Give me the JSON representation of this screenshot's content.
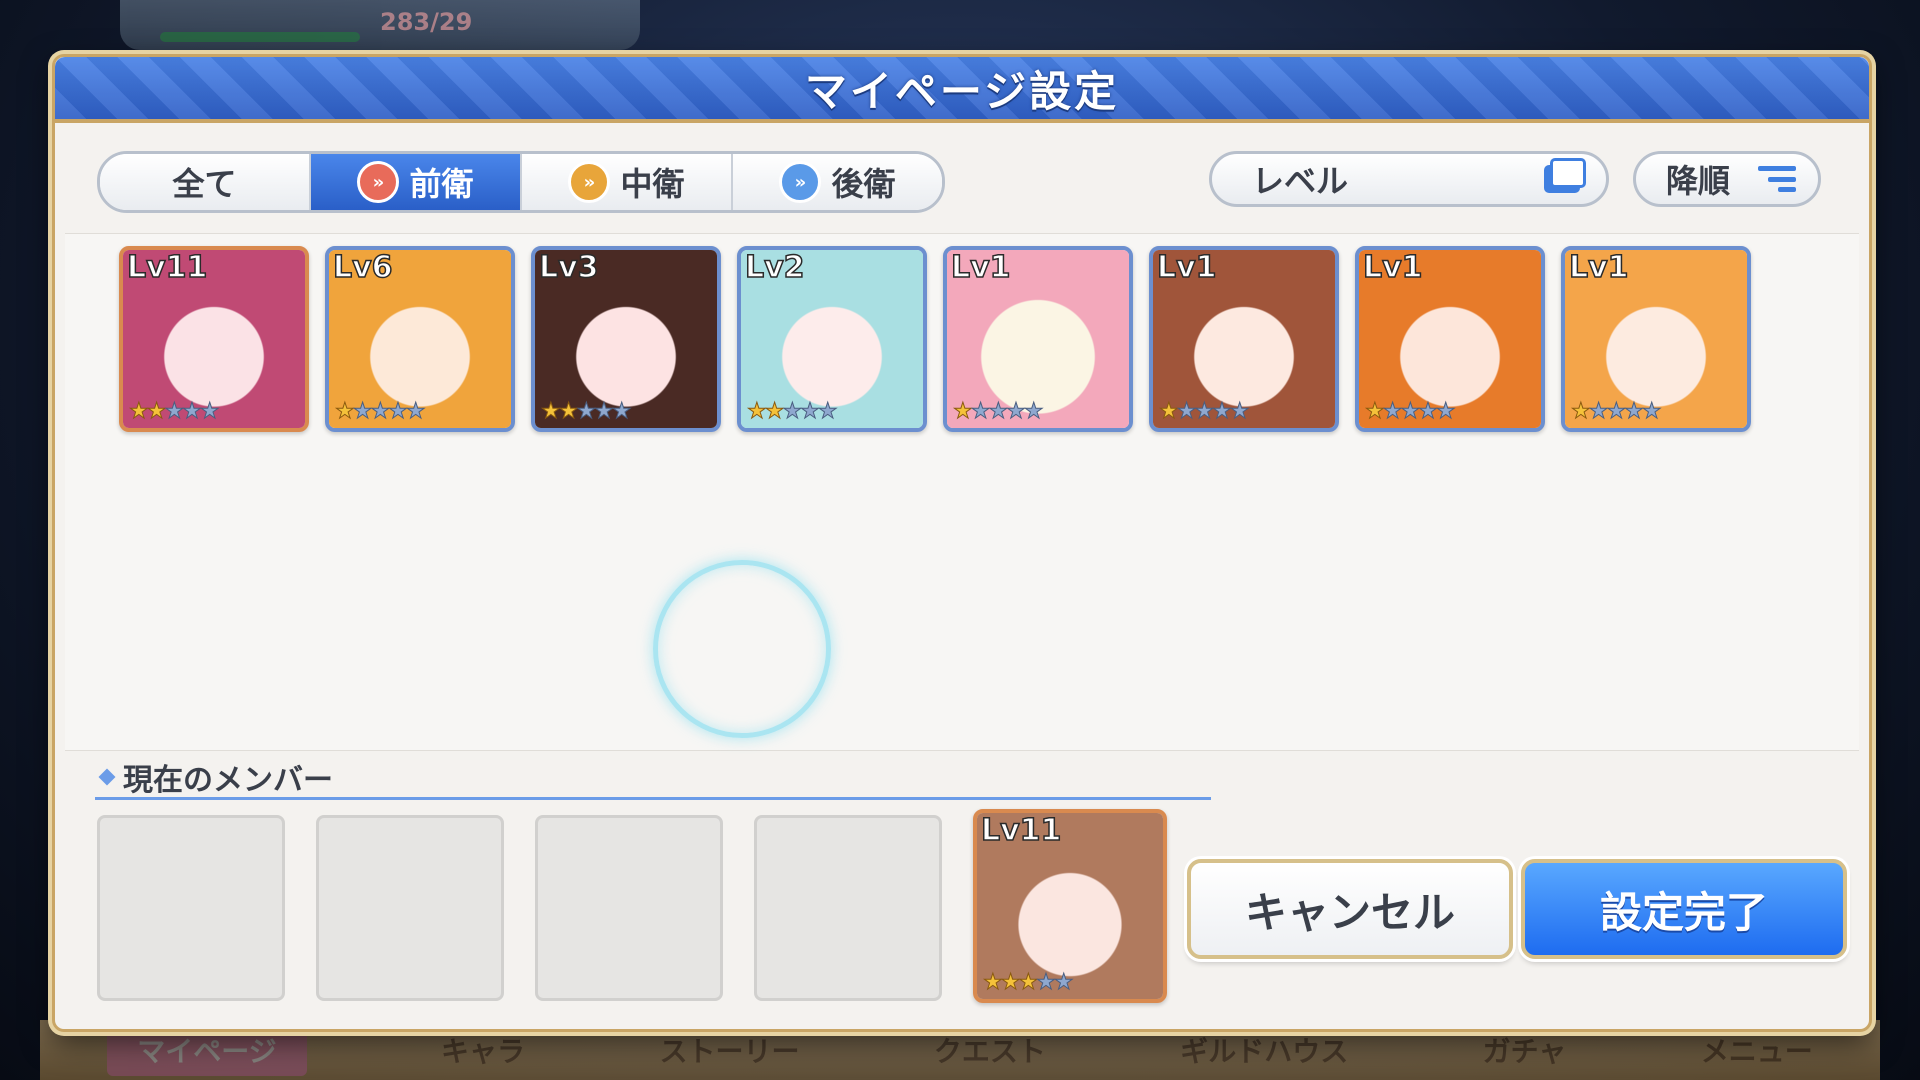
{
  "background": {
    "stamina_text": "283/29",
    "nav_items": [
      "マイページ",
      "キャラ",
      "ストーリー",
      "クエスト",
      "ギルドハウス",
      "ガチャ",
      "メニュー"
    ]
  },
  "dialog": {
    "title": "マイページ設定",
    "tabs": [
      "全て",
      "前衛",
      "中衛",
      "後衛"
    ],
    "active_tab": "前衛",
    "sort_label": "レベル",
    "order_label": "降順",
    "characters": [
      {
        "level": "Lv11",
        "stars": 2,
        "frame": "gold"
      },
      {
        "level": "Lv6",
        "stars": 1,
        "frame": "silver"
      },
      {
        "level": "Lv3",
        "stars": 2,
        "frame": "silver"
      },
      {
        "level": "Lv2",
        "stars": 2,
        "frame": "silver"
      },
      {
        "level": "Lv1",
        "stars": 1,
        "frame": "silver"
      },
      {
        "level": "Lv1",
        "stars": 1,
        "frame": "silver"
      },
      {
        "level": "Lv1",
        "stars": 1,
        "frame": "silver"
      },
      {
        "level": "Lv1",
        "stars": 1,
        "frame": "silver"
      }
    ],
    "members_label": "現在のメンバー",
    "current_member": {
      "level": "Lv11",
      "stars": 3
    },
    "cancel_label": "キャンセル",
    "confirm_label": "設定完了"
  },
  "colors": {
    "title_blue": "#2f5fc6",
    "accent_blue": "#3f7fe0",
    "gold_frame": "#d98a4f",
    "silver_frame": "#6c8fcf"
  }
}
